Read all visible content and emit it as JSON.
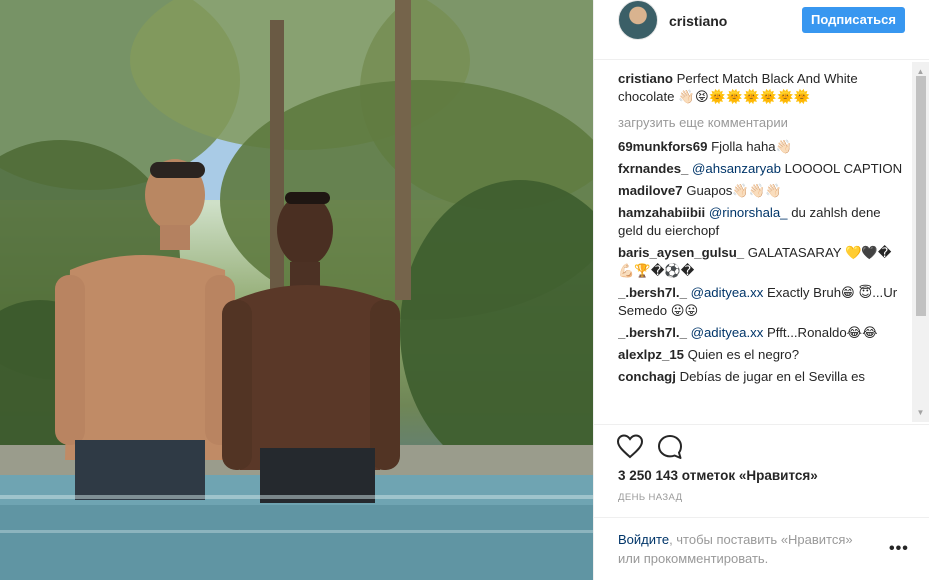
{
  "post": {
    "username": "cristiano",
    "follow_label": "Подписаться",
    "caption_user": "cristiano",
    "caption_text": "Perfect Match Black And White chocolate",
    "caption_emoji": "👋🏻😝🌞🌞🌞🌞🌞🌞",
    "load_more": "загрузить еще комментарии",
    "comments": [
      {
        "user": "69munkfors69",
        "mention": "",
        "text": "Fjolla haha👋🏻"
      },
      {
        "user": "fxrnandes_",
        "mention": "@ahsanzaryab",
        "text": "LOOOOL CAPTION"
      },
      {
        "user": "madilove7",
        "mention": "",
        "text": "Guapos👋🏻👋🏻👋🏻"
      },
      {
        "user": "hamzahabiibii",
        "mention": "@rinorshala_",
        "text": "du zahlsh dene geld du eierchopf"
      },
      {
        "user": "baris_aysen_gulsu_",
        "mention": "",
        "text": "GALATASARAY 💛🖤� 💪🏻🏆�⚽�"
      },
      {
        "user": "_.bersh7l._",
        "mention": "@adityea.xx",
        "text": "Exactly Bruh😁 😇...Ur Semedo 😛😛"
      },
      {
        "user": "_.bersh7l._",
        "mention": "@adityea.xx",
        "text": "Pfft...Ronaldo😂😂"
      },
      {
        "user": "alexlpz_15",
        "mention": "",
        "text": "Quien es el negro?"
      },
      {
        "user": "conchagj",
        "mention": "",
        "text": "Debías de jugar en el Sevilla es"
      }
    ],
    "likes": "3 250 143 отметок «Нравится»",
    "timestamp": "ДЕНЬ НАЗАД",
    "login_link": "Войдите",
    "login_text": ", чтобы поставить «Нравится» или прокомментировать.",
    "more_label": "•••",
    "icons": {
      "like": "heart-outline-icon",
      "comment": "speech-bubble-icon",
      "more": "more-dots-icon"
    }
  },
  "colors": {
    "follow_button": "#3897f0",
    "mention": "#003569",
    "muted": "#999999",
    "text": "#262626"
  }
}
